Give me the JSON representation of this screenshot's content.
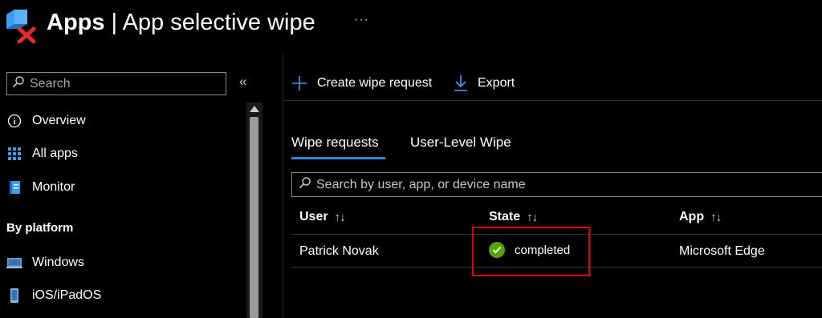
{
  "header": {
    "title_bold": "Apps",
    "title_separator": " | ",
    "title_rest": "App selective wipe",
    "more_label": "···",
    "logo_icon": "app-wipe-icon"
  },
  "sidebar": {
    "search_placeholder": "Search",
    "collapse_label": "«",
    "items": [
      {
        "label": "Overview",
        "icon": "info-icon"
      },
      {
        "label": "All apps",
        "icon": "grid-icon"
      },
      {
        "label": "Monitor",
        "icon": "monitor-book-icon"
      }
    ],
    "section_label": "By platform",
    "platform_items": [
      {
        "label": "Windows",
        "icon": "windows-device-icon"
      },
      {
        "label": "iOS/iPadOS",
        "icon": "phone-icon"
      }
    ]
  },
  "toolbar": {
    "create_label": "Create wipe request",
    "export_label": "Export"
  },
  "tabs": [
    {
      "label": "Wipe requests",
      "selected": true
    },
    {
      "label": "User-Level Wipe",
      "selected": false
    }
  ],
  "table": {
    "search_placeholder": "Search by user, app, or device name",
    "sort_glyph": "↑↓",
    "columns": [
      "User",
      "State",
      "App"
    ],
    "rows": [
      {
        "user": "Patrick Novak",
        "state": "completed",
        "app": "Microsoft Edge"
      }
    ]
  },
  "colors": {
    "accent": "#2b88d8",
    "success": "#57a300",
    "highlight": "#e50000",
    "background": "#000000"
  }
}
